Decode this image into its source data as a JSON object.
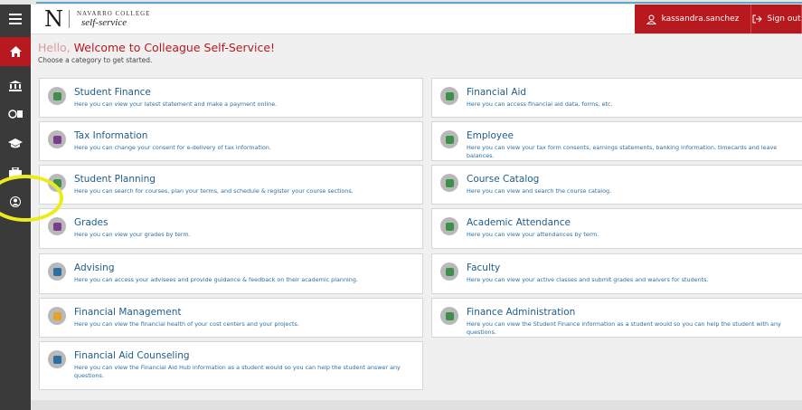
{
  "header": {
    "logo_letter": "N",
    "logo_line1": "NAVARRO COLLEGE",
    "logo_line2": "self-service",
    "username": "kassandra.sanchez",
    "signout_label": "Sign out",
    "help_label": "?"
  },
  "greeting": {
    "hello": "Hello,",
    "welcome": "Welcome to Colleague Self-Service!",
    "subtitle": "Choose a category to get started."
  },
  "sidebar": {
    "items": [
      {
        "name": "menu",
        "icon": "hamburger-icon"
      },
      {
        "name": "home",
        "icon": "home-icon"
      },
      {
        "name": "finance",
        "icon": "bank-icon"
      },
      {
        "name": "financial-aid",
        "icon": "money-icon"
      },
      {
        "name": "academics",
        "icon": "graduation-cap-icon"
      },
      {
        "name": "employee",
        "icon": "briefcase-icon"
      },
      {
        "name": "user",
        "icon": "user-icon"
      }
    ]
  },
  "cards": [
    {
      "title": "Student Finance",
      "desc": "Here you can view your latest statement and make a payment online.",
      "icon": "student-finance-icon",
      "color": "#3f8f4c"
    },
    {
      "title": "Financial Aid",
      "desc": "Here you can access financial aid data, forms, etc.",
      "icon": "financial-aid-icon",
      "color": "#3f8f4c"
    },
    {
      "title": "Tax Information",
      "desc": "Here you can change your consent for e-delivery of tax information.",
      "icon": "tax-information-icon",
      "color": "#7a3d8c"
    },
    {
      "title": "Employee",
      "desc": "Here you can view your tax form consents, earnings statements, banking information, timecards and leave balances.",
      "icon": "employee-icon",
      "color": "#3f8f4c"
    },
    {
      "title": "Student Planning",
      "desc": "Here you can search for courses, plan your terms, and schedule & register your course sections.",
      "icon": "student-planning-icon",
      "color": "#3f8f4c"
    },
    {
      "title": "Course Catalog",
      "desc": "Here you can view and search the course catalog.",
      "icon": "course-catalog-icon",
      "color": "#3f8f4c"
    },
    {
      "title": "Grades",
      "desc": "Here you can view your grades by term.",
      "icon": "grades-icon",
      "color": "#7a3d8c"
    },
    {
      "title": "Academic Attendance",
      "desc": "Here you can view your attendances by term.",
      "icon": "academic-attendance-icon",
      "color": "#3f8f4c"
    },
    {
      "title": "Advising",
      "desc": "Here you can access your advisees and provide guidance & feedback on their academic planning.",
      "icon": "advising-icon",
      "color": "#2c6fa3"
    },
    {
      "title": "Faculty",
      "desc": "Here you can view your active classes and submit grades and waivers for students.",
      "icon": "faculty-icon",
      "color": "#3f8f4c"
    },
    {
      "title": "Financial Management",
      "desc": "Here you can view the financial health of your cost centers and your projects.",
      "icon": "financial-management-icon",
      "color": "#e2a22b"
    },
    {
      "title": "Finance Administration",
      "desc": "Here you can view the Student Finance information as a student would so you can help the student with any questions.",
      "icon": "finance-administration-icon",
      "color": "#3f8f4c"
    },
    {
      "title": "Financial Aid Counseling",
      "desc": "Here you can view the Financial Aid Hub information as a student would so you can help the student answer any questions.",
      "icon": "financial-aid-counseling-icon",
      "color": "#2c6fa3"
    }
  ]
}
